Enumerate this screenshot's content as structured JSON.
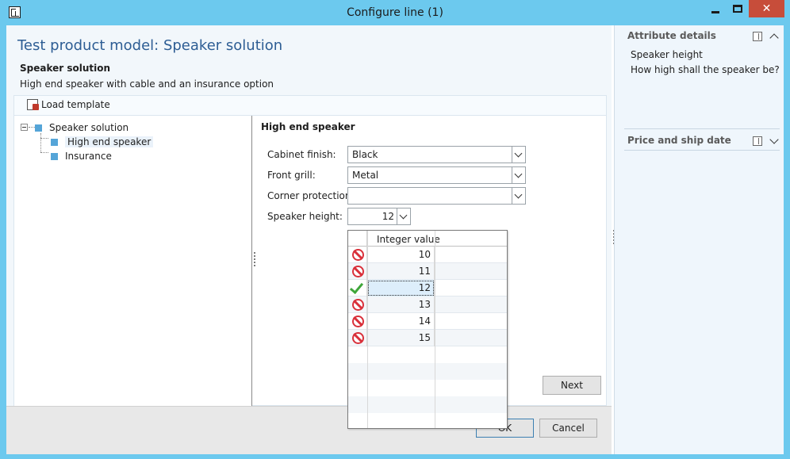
{
  "window": {
    "title": "Configure line (1)",
    "close_glyph": "✕"
  },
  "main": {
    "page_title": "Test product model: Speaker solution",
    "model_name": "Speaker solution",
    "model_description": "High end speaker with cable and an insurance option"
  },
  "toolbar": {
    "load_template_label": "Load template"
  },
  "tree": {
    "root": "Speaker solution",
    "children": [
      "High end speaker",
      "Insurance"
    ],
    "selected": "High end speaker"
  },
  "form": {
    "group_title": "High end speaker",
    "fields": [
      {
        "label": "Cabinet finish:",
        "value": "Black"
      },
      {
        "label": "Front grill:",
        "value": "Metal"
      },
      {
        "label": "Corner protection:",
        "value": ""
      },
      {
        "label": "Speaker height:",
        "value": "12"
      }
    ],
    "next_label": "Next"
  },
  "dropdown": {
    "column_header": "Integer value",
    "rows": [
      {
        "value": "10",
        "status": "not-allowed"
      },
      {
        "value": "11",
        "status": "not-allowed"
      },
      {
        "value": "12",
        "status": "allowed"
      },
      {
        "value": "13",
        "status": "not-allowed"
      },
      {
        "value": "14",
        "status": "not-allowed"
      },
      {
        "value": "15",
        "status": "not-allowed"
      }
    ],
    "selected_value": "12"
  },
  "footer": {
    "ok_label": "OK",
    "cancel_label": "Cancel"
  },
  "facts": {
    "attribute_details_title": "Attribute details",
    "attribute_name": "Speaker height",
    "attribute_question": "How high shall the speaker be?",
    "price_ship_title": "Price and ship date"
  },
  "colors": {
    "title_bar": "#6cc9ee",
    "page_title": "#2d5d94",
    "close_button": "#c74d3a",
    "not_allowed_icon": "#d9303a",
    "allowed_icon": "#3fa63a"
  }
}
